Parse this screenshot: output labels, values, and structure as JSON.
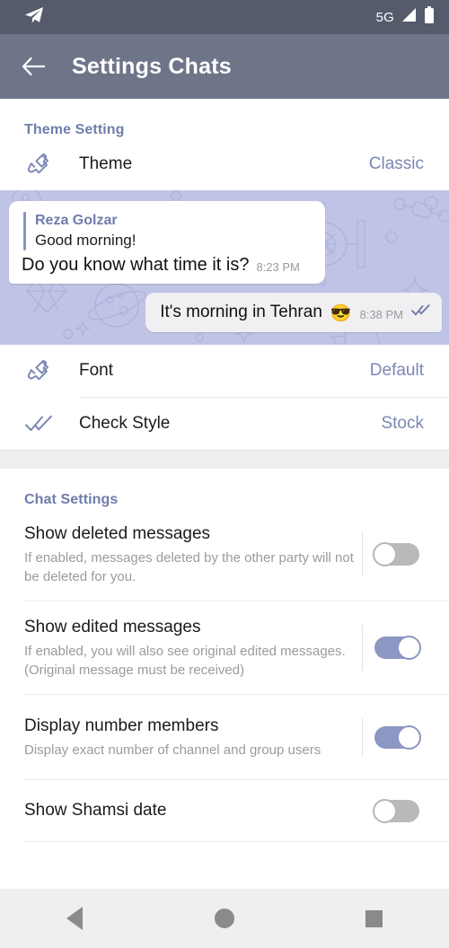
{
  "status_bar": {
    "app_icon": "telegram-send-icon",
    "network": "5G",
    "signal_icon": "signal-bars-icon",
    "battery_icon": "battery-full-icon"
  },
  "app_bar": {
    "back_icon": "arrow-left-icon",
    "title": "Settings Chats"
  },
  "theme_section": {
    "header": "Theme Setting",
    "rows": [
      {
        "icon": "paint-brush-icon",
        "label": "Theme",
        "value": "Classic"
      },
      {
        "icon": "paint-brush-icon",
        "label": "Font",
        "value": "Default"
      },
      {
        "icon": "double-check-icon",
        "label": "Check Style",
        "value": "Stock"
      }
    ]
  },
  "chat_preview": {
    "wallpaper": "space-pattern",
    "incoming": {
      "reply_name": "Reza Golzar",
      "reply_text": "Good morning!",
      "text": "Do you know what time it is?",
      "time": "8:23 PM"
    },
    "outgoing": {
      "text": "It's morning in Tehran",
      "emoji": "😎",
      "time": "8:38 PM",
      "status_icon": "double-check-icon"
    }
  },
  "chat_settings": {
    "header": "Chat Settings",
    "items": [
      {
        "title": "Show deleted messages",
        "subtitle": "If enabled, messages deleted by the other party will not be deleted for you.",
        "state": "off"
      },
      {
        "title": "Show edited messages",
        "subtitle": "If enabled, you will also see original edited messages.(Original message must be received)",
        "state": "on"
      },
      {
        "title": "Display number members",
        "subtitle": "Display exact number of channel and group users",
        "state": "on"
      },
      {
        "title": "Show Shamsi date",
        "subtitle": "",
        "state": "off"
      }
    ]
  },
  "nav_bar": {
    "back": "nav-back-icon",
    "home": "nav-home-icon",
    "recents": "nav-recents-icon"
  },
  "colors": {
    "status_bar": "#555b6b",
    "app_bar": "#6f7589",
    "accent": "#6f7daa",
    "switch_on": "#8d97c3",
    "switch_off": "#b9b9bb",
    "wallpaper": "#bfc3e6"
  }
}
